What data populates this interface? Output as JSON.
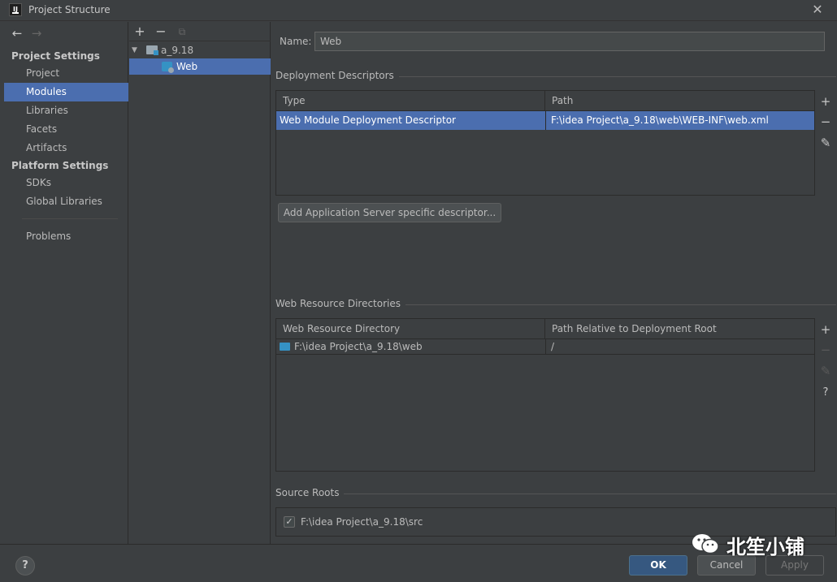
{
  "window": {
    "title": "Project Structure",
    "app_icon_text": "IJ",
    "close_glyph": "✕"
  },
  "nav": {
    "back_glyph": "←",
    "forward_glyph": "→",
    "project_settings_header": "Project Settings",
    "platform_settings_header": "Platform Settings",
    "items": [
      {
        "label": "Project"
      },
      {
        "label": "Modules"
      },
      {
        "label": "Libraries"
      },
      {
        "label": "Facets"
      },
      {
        "label": "Artifacts"
      },
      {
        "label": "SDKs"
      },
      {
        "label": "Global Libraries"
      },
      {
        "label": "Problems"
      }
    ],
    "selected": "Modules"
  },
  "tree": {
    "toolbar": {
      "add": "+",
      "remove": "−",
      "copy": "⧉"
    },
    "root": {
      "label": "a_9.18",
      "expanded": true
    },
    "child": {
      "label": "Web",
      "selected": true
    }
  },
  "content": {
    "name_label": "Name:",
    "name_value": "Web",
    "deployment": {
      "title": "Deployment Descriptors",
      "headers": [
        "Type",
        "Path"
      ],
      "rows": [
        {
          "type": "Web Module Deployment Descriptor",
          "path": "F:\\idea Project\\a_9.18\\web\\WEB-INF\\web.xml"
        }
      ],
      "add_server_button": "Add Application Server specific descriptor...",
      "side_buttons": {
        "add": "+",
        "remove": "−",
        "edit": "✎"
      }
    },
    "web_resources": {
      "title": "Web Resource Directories",
      "headers": [
        "Web Resource Directory",
        "Path Relative to Deployment Root"
      ],
      "rows": [
        {
          "directory": "F:\\idea Project\\a_9.18\\web",
          "relative": "/"
        }
      ],
      "side_buttons": {
        "add": "+",
        "remove": "−",
        "edit": "✎",
        "help": "?"
      }
    },
    "source_roots": {
      "title": "Source Roots",
      "items": [
        {
          "label": "F:\\idea Project\\a_9.18\\src",
          "checked": true
        }
      ],
      "check_glyph": "✓"
    }
  },
  "footer": {
    "help": "?",
    "ok": "OK",
    "cancel": "Cancel",
    "apply": "Apply"
  },
  "watermark": {
    "text": "北笙小铺"
  },
  "colors": {
    "accent": "#4b6eaf",
    "background": "#3c3f41",
    "ok_button": "#365880"
  }
}
